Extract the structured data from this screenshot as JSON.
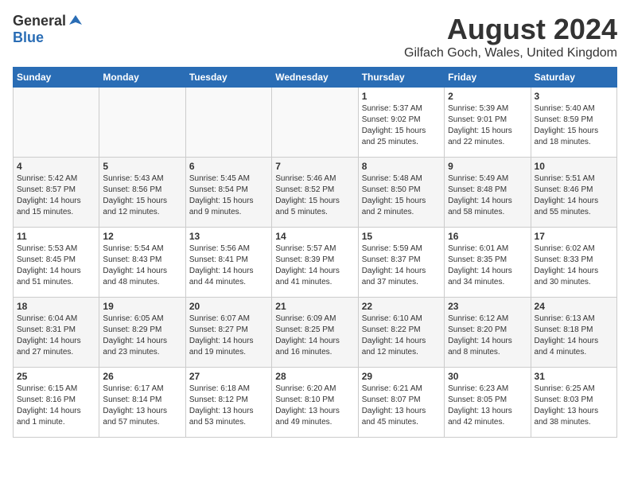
{
  "header": {
    "logo_general": "General",
    "logo_blue": "Blue",
    "month_year": "August 2024",
    "location": "Gilfach Goch, Wales, United Kingdom"
  },
  "days_of_week": [
    "Sunday",
    "Monday",
    "Tuesday",
    "Wednesday",
    "Thursday",
    "Friday",
    "Saturday"
  ],
  "weeks": [
    [
      {
        "day": "",
        "empty": true
      },
      {
        "day": "",
        "empty": true
      },
      {
        "day": "",
        "empty": true
      },
      {
        "day": "",
        "empty": true
      },
      {
        "day": "1",
        "sunrise": "5:37 AM",
        "sunset": "9:02 PM",
        "daylight": "15 hours and 25 minutes."
      },
      {
        "day": "2",
        "sunrise": "5:39 AM",
        "sunset": "9:01 PM",
        "daylight": "15 hours and 22 minutes."
      },
      {
        "day": "3",
        "sunrise": "5:40 AM",
        "sunset": "8:59 PM",
        "daylight": "15 hours and 18 minutes."
      }
    ],
    [
      {
        "day": "4",
        "sunrise": "5:42 AM",
        "sunset": "8:57 PM",
        "daylight": "14 hours and 15 minutes."
      },
      {
        "day": "5",
        "sunrise": "5:43 AM",
        "sunset": "8:56 PM",
        "daylight": "15 hours and 12 minutes."
      },
      {
        "day": "6",
        "sunrise": "5:45 AM",
        "sunset": "8:54 PM",
        "daylight": "15 hours and 9 minutes."
      },
      {
        "day": "7",
        "sunrise": "5:46 AM",
        "sunset": "8:52 PM",
        "daylight": "15 hours and 5 minutes."
      },
      {
        "day": "8",
        "sunrise": "5:48 AM",
        "sunset": "8:50 PM",
        "daylight": "15 hours and 2 minutes."
      },
      {
        "day": "9",
        "sunrise": "5:49 AM",
        "sunset": "8:48 PM",
        "daylight": "14 hours and 58 minutes."
      },
      {
        "day": "10",
        "sunrise": "5:51 AM",
        "sunset": "8:46 PM",
        "daylight": "14 hours and 55 minutes."
      }
    ],
    [
      {
        "day": "11",
        "sunrise": "5:53 AM",
        "sunset": "8:45 PM",
        "daylight": "14 hours and 51 minutes."
      },
      {
        "day": "12",
        "sunrise": "5:54 AM",
        "sunset": "8:43 PM",
        "daylight": "14 hours and 48 minutes."
      },
      {
        "day": "13",
        "sunrise": "5:56 AM",
        "sunset": "8:41 PM",
        "daylight": "14 hours and 44 minutes."
      },
      {
        "day": "14",
        "sunrise": "5:57 AM",
        "sunset": "8:39 PM",
        "daylight": "14 hours and 41 minutes."
      },
      {
        "day": "15",
        "sunrise": "5:59 AM",
        "sunset": "8:37 PM",
        "daylight": "14 hours and 37 minutes."
      },
      {
        "day": "16",
        "sunrise": "6:01 AM",
        "sunset": "8:35 PM",
        "daylight": "14 hours and 34 minutes."
      },
      {
        "day": "17",
        "sunrise": "6:02 AM",
        "sunset": "8:33 PM",
        "daylight": "14 hours and 30 minutes."
      }
    ],
    [
      {
        "day": "18",
        "sunrise": "6:04 AM",
        "sunset": "8:31 PM",
        "daylight": "14 hours and 27 minutes."
      },
      {
        "day": "19",
        "sunrise": "6:05 AM",
        "sunset": "8:29 PM",
        "daylight": "14 hours and 23 minutes."
      },
      {
        "day": "20",
        "sunrise": "6:07 AM",
        "sunset": "8:27 PM",
        "daylight": "14 hours and 19 minutes."
      },
      {
        "day": "21",
        "sunrise": "6:09 AM",
        "sunset": "8:25 PM",
        "daylight": "14 hours and 16 minutes."
      },
      {
        "day": "22",
        "sunrise": "6:10 AM",
        "sunset": "8:22 PM",
        "daylight": "14 hours and 12 minutes."
      },
      {
        "day": "23",
        "sunrise": "6:12 AM",
        "sunset": "8:20 PM",
        "daylight": "14 hours and 8 minutes."
      },
      {
        "day": "24",
        "sunrise": "6:13 AM",
        "sunset": "8:18 PM",
        "daylight": "14 hours and 4 minutes."
      }
    ],
    [
      {
        "day": "25",
        "sunrise": "6:15 AM",
        "sunset": "8:16 PM",
        "daylight": "14 hours and 1 minute."
      },
      {
        "day": "26",
        "sunrise": "6:17 AM",
        "sunset": "8:14 PM",
        "daylight": "13 hours and 57 minutes."
      },
      {
        "day": "27",
        "sunrise": "6:18 AM",
        "sunset": "8:12 PM",
        "daylight": "13 hours and 53 minutes."
      },
      {
        "day": "28",
        "sunrise": "6:20 AM",
        "sunset": "8:10 PM",
        "daylight": "13 hours and 49 minutes."
      },
      {
        "day": "29",
        "sunrise": "6:21 AM",
        "sunset": "8:07 PM",
        "daylight": "13 hours and 45 minutes."
      },
      {
        "day": "30",
        "sunrise": "6:23 AM",
        "sunset": "8:05 PM",
        "daylight": "13 hours and 42 minutes."
      },
      {
        "day": "31",
        "sunrise": "6:25 AM",
        "sunset": "8:03 PM",
        "daylight": "13 hours and 38 minutes."
      }
    ]
  ]
}
